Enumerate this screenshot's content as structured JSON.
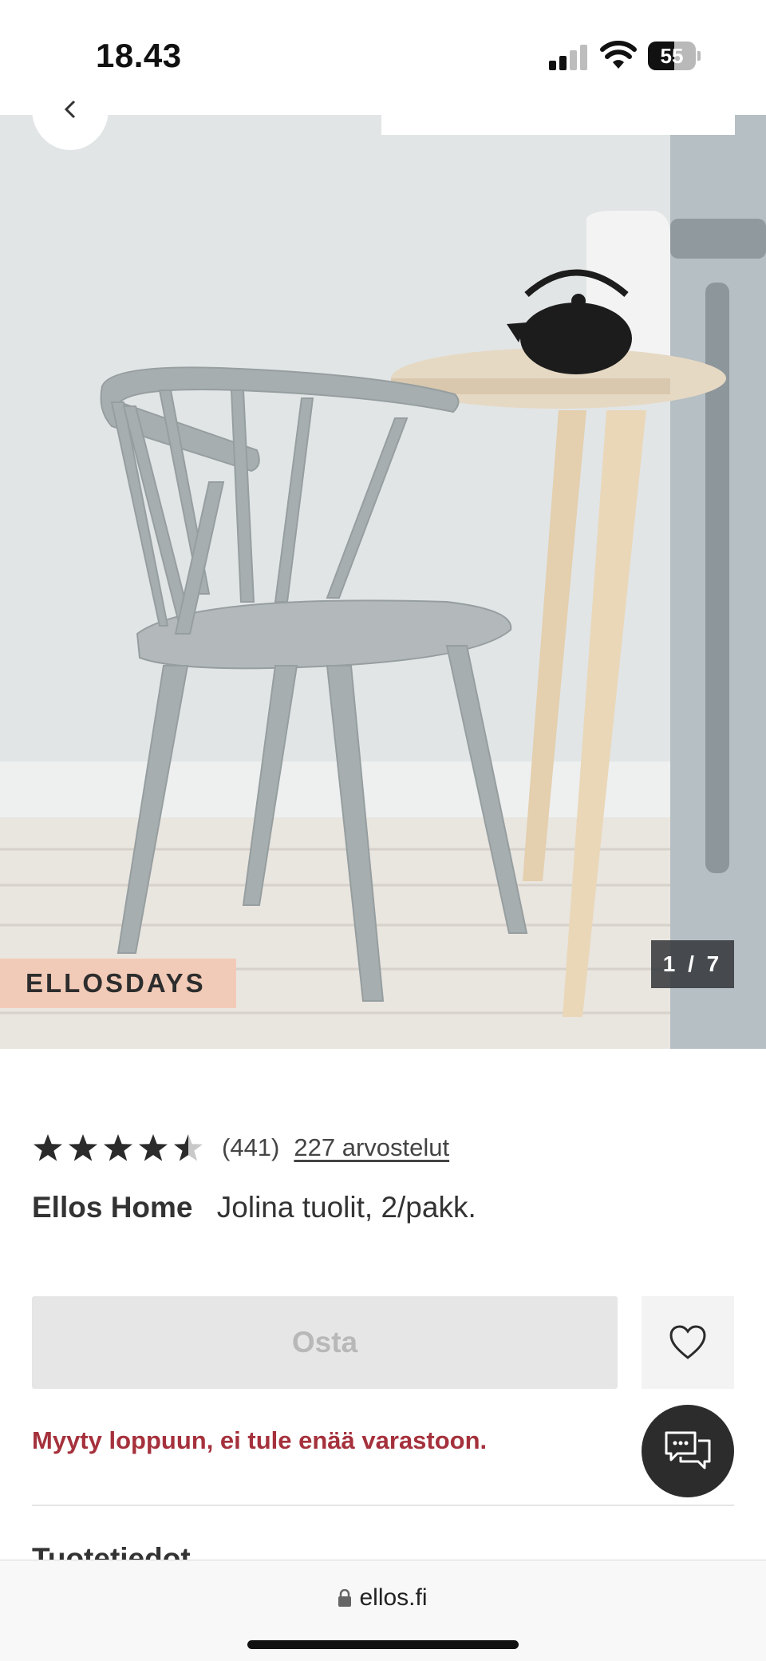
{
  "status_bar": {
    "time": "18.43",
    "battery": "55",
    "battery_level": 0.55
  },
  "gallery": {
    "promo_badge": "ELLOSDAYS",
    "image_counter": "1 / 7"
  },
  "product": {
    "rating_value": 4.5,
    "rating_max": 5,
    "rating_count": "(441)",
    "reviews_link": "227 arvostelut",
    "brand": "Ellos Home",
    "name": "Jolina tuolit, 2/pakk.",
    "buy_label": "Osta",
    "soldout_message": "Myyty loppuun, ei tule enää varastoon.",
    "next_section_label": "Tuotetiedot"
  },
  "browser": {
    "url": "ellos.fi"
  },
  "colors": {
    "soldout": "#a5313c",
    "promo": "#f2cbb8",
    "buy_disabled": "#e6e6e6"
  },
  "icons": {
    "back": "chevron-left-icon",
    "favorite": "heart-icon",
    "chat": "chat-bubbles-icon",
    "lock": "lock-icon",
    "star": "star-icon"
  }
}
